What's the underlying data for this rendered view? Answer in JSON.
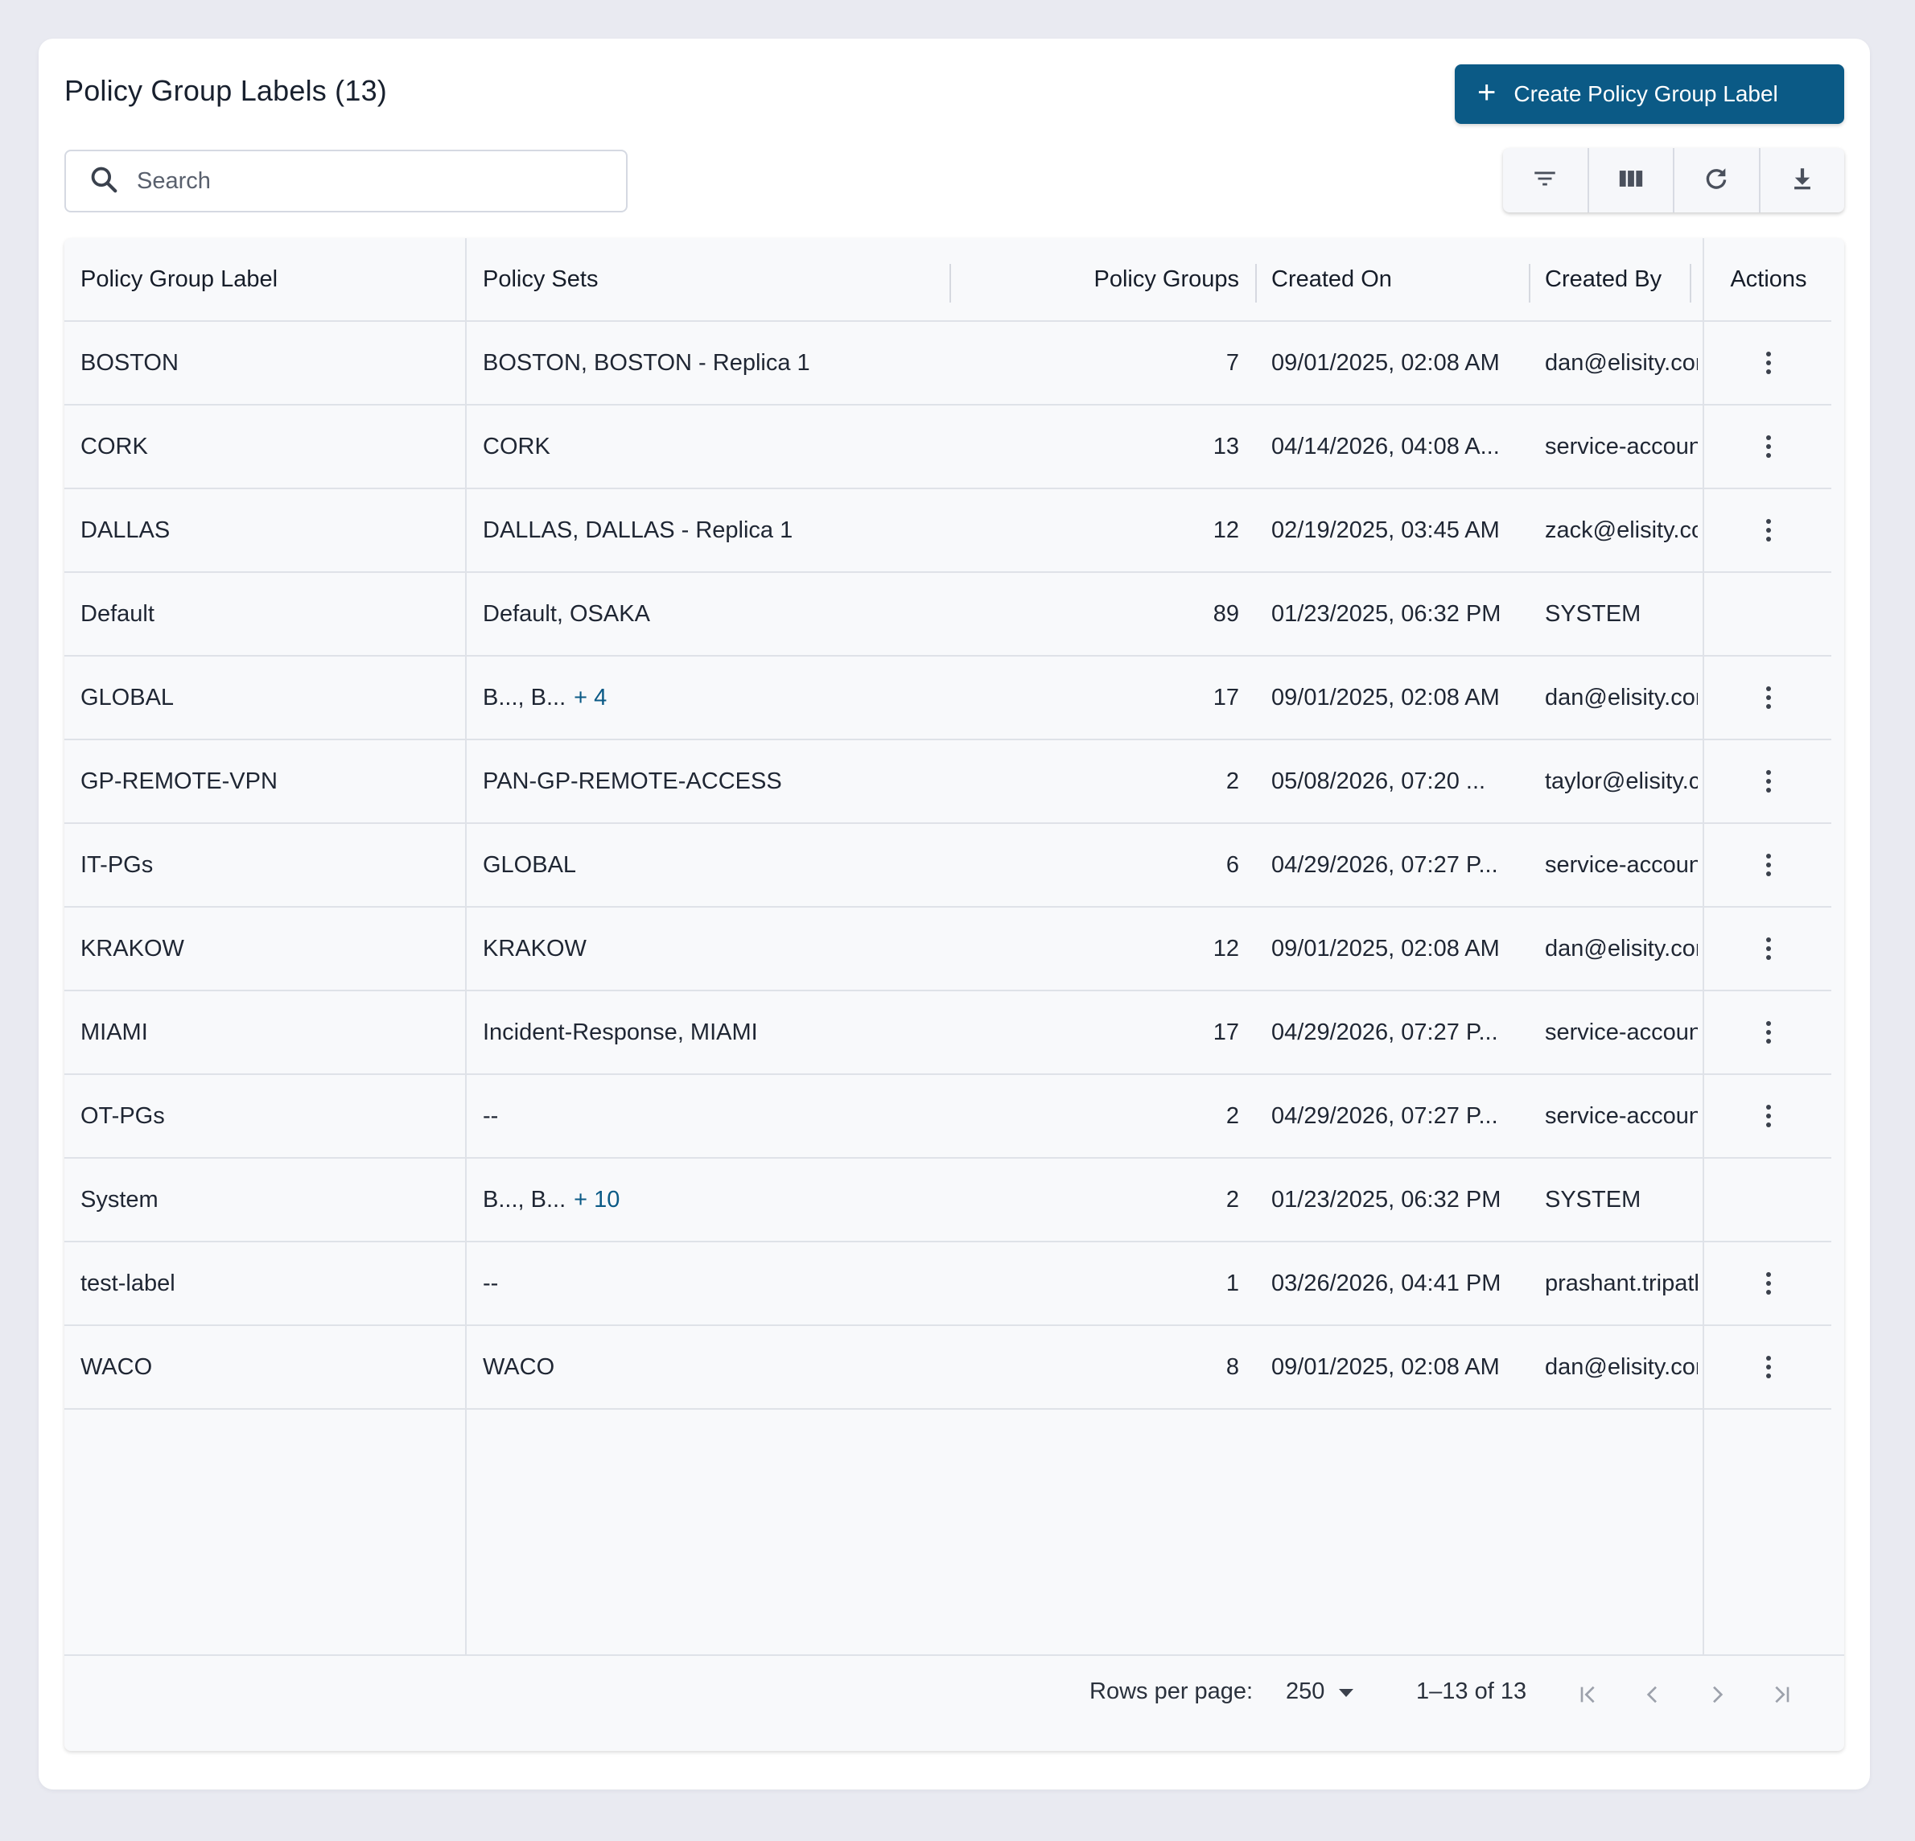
{
  "page": {
    "title": "Policy Group Labels (13)",
    "create_button": "Create Policy Group Label",
    "search_placeholder": "Search"
  },
  "toolbar": {
    "icons": [
      "filter-icon",
      "columns-icon",
      "refresh-icon",
      "download-icon"
    ]
  },
  "table": {
    "columns": [
      "Policy Group Label",
      "Policy Sets",
      "Policy Groups",
      "Created On",
      "Created By",
      "Actions"
    ],
    "rows": [
      {
        "label": "BOSTON",
        "sets": "BOSTON, BOSTON - Replica 1",
        "more": "",
        "groups": "7",
        "created_on": "09/01/2025, 02:08 AM",
        "created_by": "dan@elisity.com",
        "actions": true
      },
      {
        "label": "CORK",
        "sets": "CORK",
        "more": "",
        "groups": "13",
        "created_on": "04/14/2026, 04:08 A...",
        "created_by": "service-accoun...",
        "actions": true
      },
      {
        "label": "DALLAS",
        "sets": "DALLAS, DALLAS - Replica 1",
        "more": "",
        "groups": "12",
        "created_on": "02/19/2025, 03:45 AM",
        "created_by": "zack@elisity.com",
        "actions": true
      },
      {
        "label": "Default",
        "sets": "Default, OSAKA",
        "more": "",
        "groups": "89",
        "created_on": "01/23/2025, 06:32 PM",
        "created_by": "SYSTEM",
        "actions": false
      },
      {
        "label": "GLOBAL",
        "sets": "B..., B...",
        "more": "+ 4",
        "groups": "17",
        "created_on": "09/01/2025, 02:08 AM",
        "created_by": "dan@elisity.com",
        "actions": true
      },
      {
        "label": "GP-REMOTE-VPN",
        "sets": "PAN-GP-REMOTE-ACCESS",
        "more": "",
        "groups": "2",
        "created_on": "05/08/2026, 07:20 ...",
        "created_by": "taylor@elisity.c...",
        "actions": true
      },
      {
        "label": "IT-PGs",
        "sets": "GLOBAL",
        "more": "",
        "groups": "6",
        "created_on": "04/29/2026, 07:27 P...",
        "created_by": "service-accoun...",
        "actions": true
      },
      {
        "label": "KRAKOW",
        "sets": "KRAKOW",
        "more": "",
        "groups": "12",
        "created_on": "09/01/2025, 02:08 AM",
        "created_by": "dan@elisity.com",
        "actions": true
      },
      {
        "label": "MIAMI",
        "sets": "Incident-Response, MIAMI",
        "more": "",
        "groups": "17",
        "created_on": "04/29/2026, 07:27 P...",
        "created_by": "service-accoun...",
        "actions": true
      },
      {
        "label": "OT-PGs",
        "sets": "--",
        "more": "",
        "groups": "2",
        "created_on": "04/29/2026, 07:27 P...",
        "created_by": "service-accoun...",
        "actions": true
      },
      {
        "label": "System",
        "sets": "B..., B...",
        "more": "+ 10",
        "groups": "2",
        "created_on": "01/23/2025, 06:32 PM",
        "created_by": "SYSTEM",
        "actions": false
      },
      {
        "label": "test-label",
        "sets": "--",
        "more": "",
        "groups": "1",
        "created_on": "03/26/2026, 04:41 PM",
        "created_by": "prashant.tripath...",
        "actions": true
      },
      {
        "label": "WACO",
        "sets": "WACO",
        "more": "",
        "groups": "8",
        "created_on": "09/01/2025, 02:08 AM",
        "created_by": "dan@elisity.com",
        "actions": true
      }
    ]
  },
  "pagination": {
    "rows_per_page_label": "Rows per page:",
    "rows_per_page_value": "250",
    "range": "1–13 of 13"
  },
  "colors": {
    "accent": "#0b5a86",
    "background": "#e9eaf1",
    "grid_background": "#f8f9fb"
  }
}
